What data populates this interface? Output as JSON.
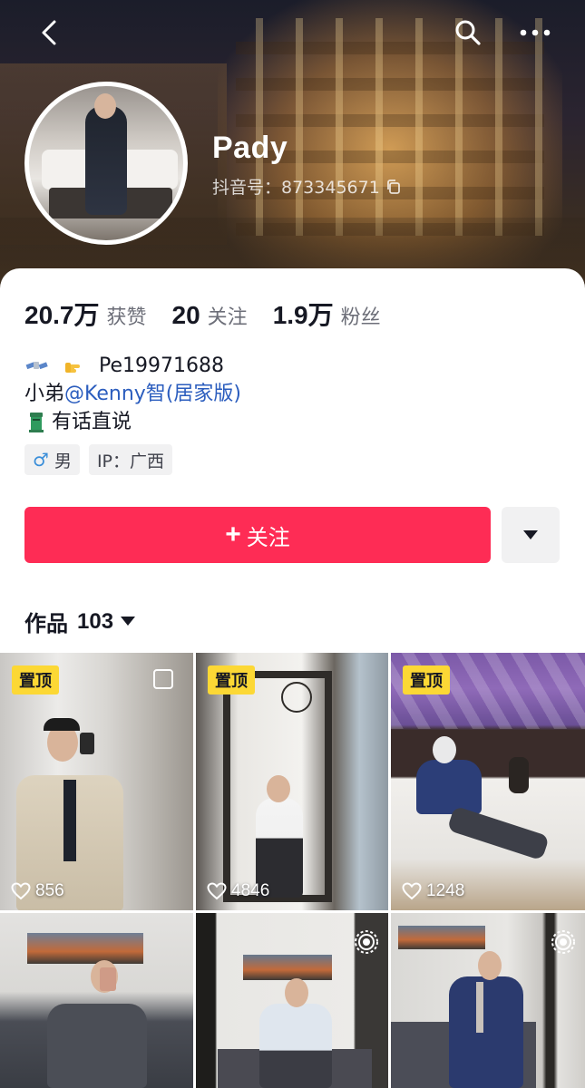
{
  "profile": {
    "name": "Pady",
    "douyin_id": "抖音号：873345671"
  },
  "stats": [
    {
      "number": "20.7万",
      "label": "获赞"
    },
    {
      "number": "20",
      "label": "关注"
    },
    {
      "number": "1.9万",
      "label": "粉丝"
    }
  ],
  "bio": {
    "line1": "Pe19971688",
    "line2_prefix": "小弟",
    "line2_mention": "@Kenny智(居家版)",
    "line3": "有话直说"
  },
  "tags": {
    "gender_symbol": "♂",
    "gender": "男",
    "ip": "IP：广西"
  },
  "actions": {
    "follow_plus": "+",
    "follow_label": "关注"
  },
  "works": {
    "label": "作品",
    "count": "103"
  },
  "videos": [
    {
      "pinned": true,
      "pin_label": "置顶",
      "likes": "856"
    },
    {
      "pinned": true,
      "pin_label": "置顶",
      "likes": "4846"
    },
    {
      "pinned": true,
      "pin_label": "置顶",
      "likes": "1248"
    },
    {
      "pinned": false,
      "likes": ""
    },
    {
      "pinned": false,
      "likes": ""
    },
    {
      "pinned": false,
      "likes": ""
    }
  ],
  "colors": {
    "accent": "#fe2c55",
    "pin": "#fcd835",
    "mention": "#2b5dbe"
  },
  "icons": [
    "back-icon",
    "search-icon",
    "more-icon",
    "copy-icon",
    "dropdown-caret-icon",
    "heart-icon",
    "live-icon"
  ]
}
